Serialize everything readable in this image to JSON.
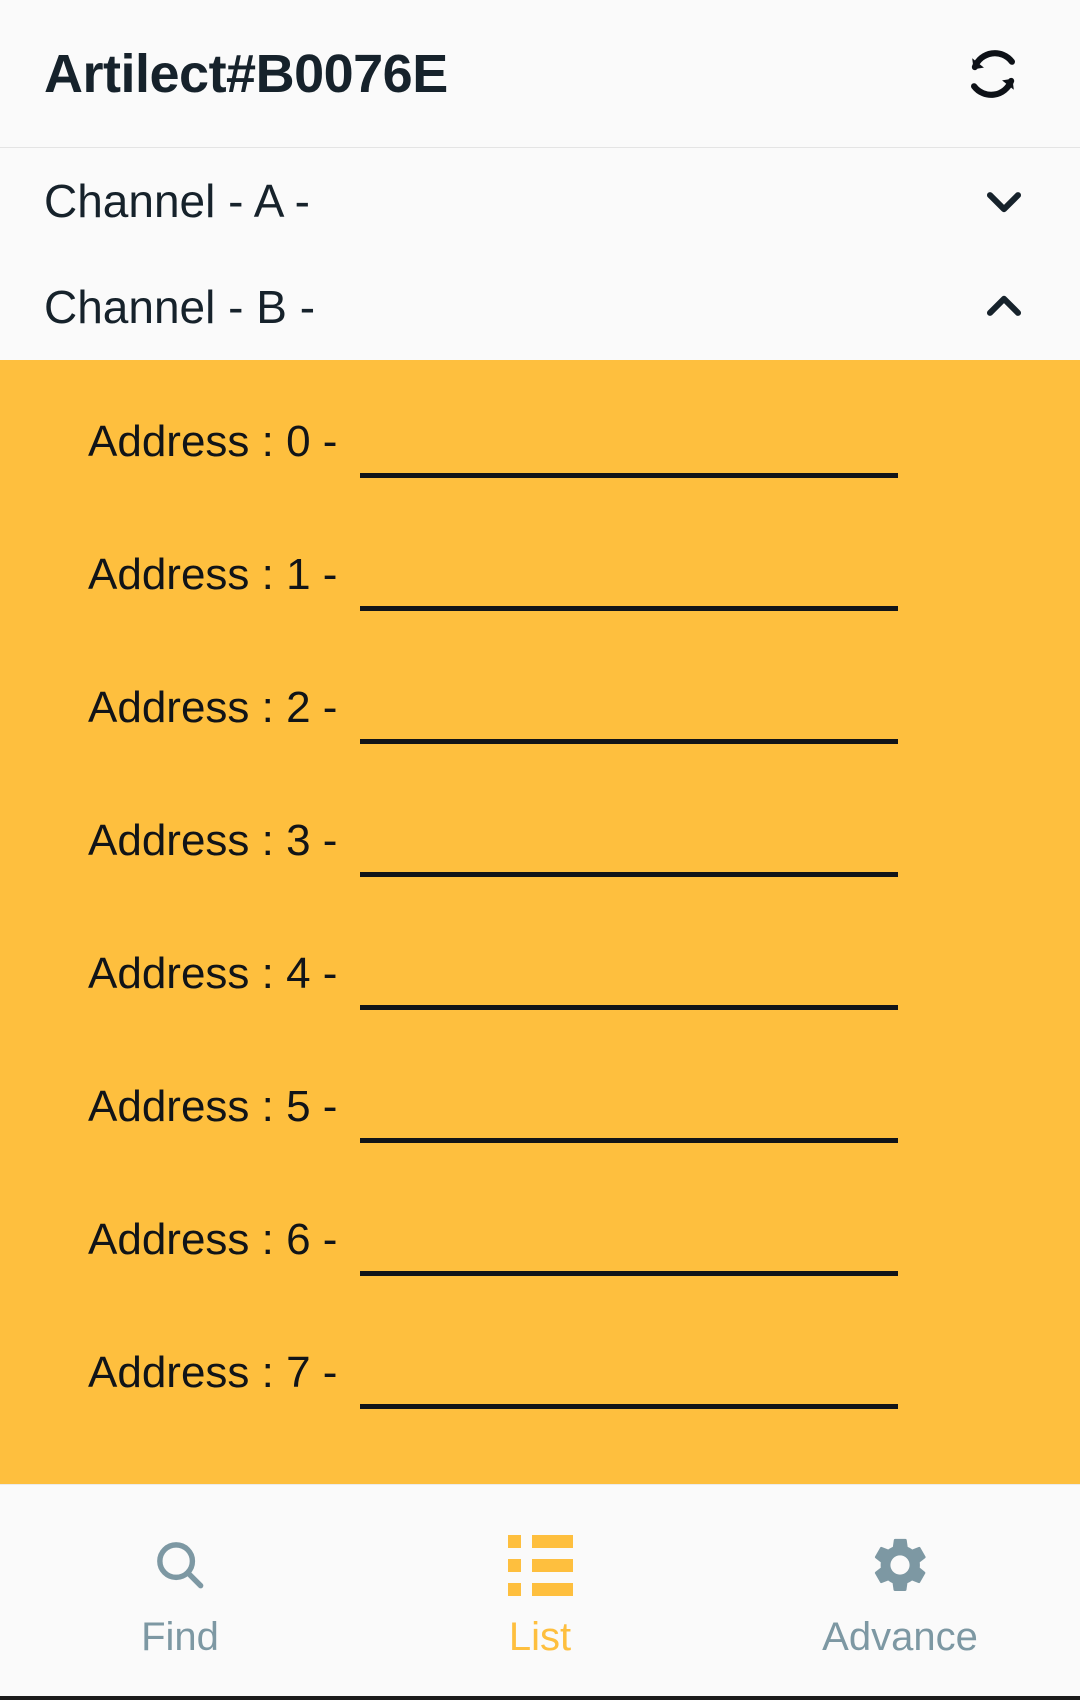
{
  "appbar": {
    "title": "Artilect#B0076E",
    "refresh_icon": "refresh-sync-icon"
  },
  "channels": [
    {
      "label": "Channel - A -",
      "expanded": false,
      "chevron_icon": "chevron-down-icon"
    },
    {
      "label": "Channel - B -",
      "expanded": true,
      "chevron_icon": "chevron-up-icon"
    }
  ],
  "addresses": [
    {
      "label": "Address : 0 -",
      "value": "",
      "placeholder": ""
    },
    {
      "label": "Address : 1 -",
      "value": "",
      "placeholder": ""
    },
    {
      "label": "Address : 2 -",
      "value": "",
      "placeholder": ""
    },
    {
      "label": "Address : 3 -",
      "value": "",
      "placeholder": ""
    },
    {
      "label": "Address : 4 -",
      "value": "",
      "placeholder": ""
    },
    {
      "label": "Address : 5 -",
      "value": "",
      "placeholder": ""
    },
    {
      "label": "Address : 6 -",
      "value": "",
      "placeholder": ""
    },
    {
      "label": "Address : 7 -",
      "value": "",
      "placeholder": ""
    }
  ],
  "bottom_nav": {
    "items": [
      {
        "label": "Find",
        "icon": "search-icon",
        "active": false
      },
      {
        "label": "List",
        "icon": "list-icon",
        "active": true
      },
      {
        "label": "Advance",
        "icon": "gear-icon",
        "active": false
      }
    ]
  },
  "colors": {
    "accent": "#febf3e",
    "panel_background": "#febf3e",
    "surface": "#fafafa",
    "text_primary": "#16222b",
    "nav_inactive": "#7d98a3",
    "field_underline": "#111418"
  }
}
